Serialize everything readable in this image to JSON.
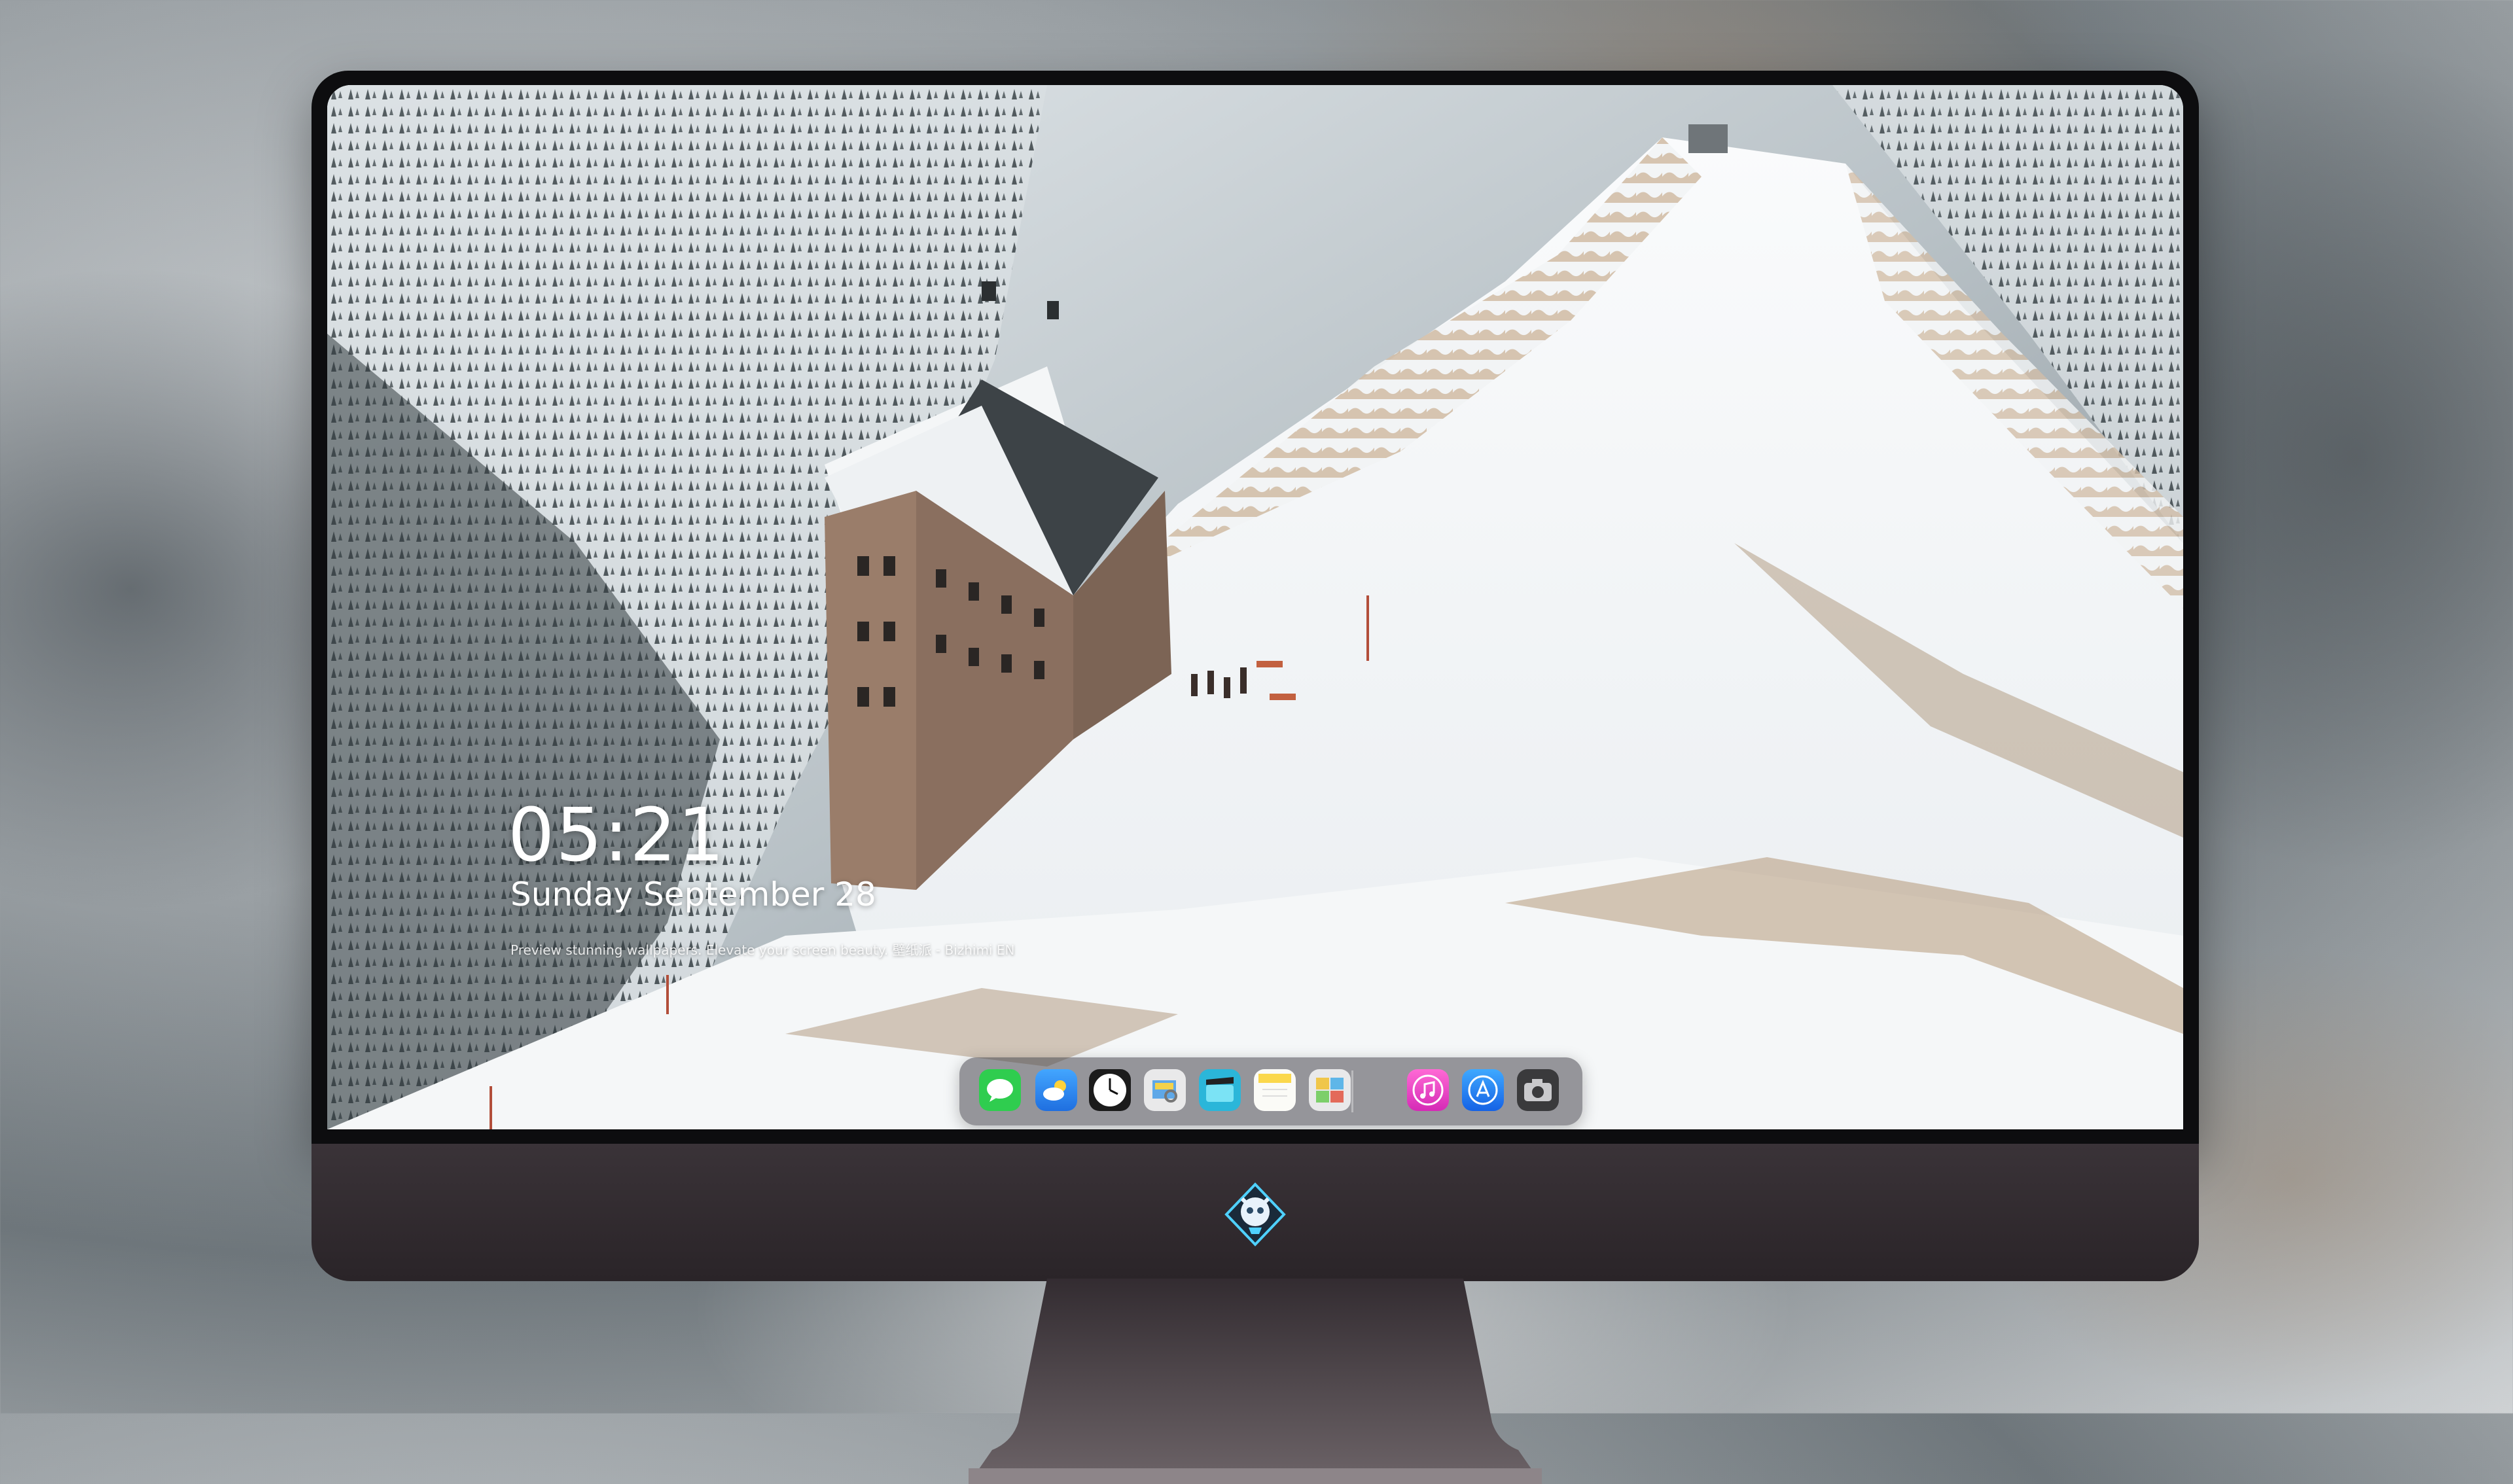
{
  "lockscreen": {
    "time": "05:21",
    "date": "Sunday September  28",
    "caption": "Preview stunning wallpapers. Elevate your screen beauty. 壁纸派 - Bizhimi EN"
  },
  "dock": {
    "apps": [
      {
        "name": "messages-icon",
        "color": "#2fcd4f"
      },
      {
        "name": "weather-icon",
        "color": "#2d8ff0"
      },
      {
        "name": "clock-icon",
        "color": "#1b1b1b"
      },
      {
        "name": "preview-icon",
        "color": "#f3d24a"
      },
      {
        "name": "clips-icon",
        "color": "#2bb6d9"
      },
      {
        "name": "notes-icon",
        "color": "#fbd84c"
      },
      {
        "name": "photo-browser-icon",
        "color": "#e9e9ea"
      },
      {
        "name": "music-icon",
        "color": "#f14dc8"
      },
      {
        "name": "app-store-icon",
        "color": "#1e7cf2"
      },
      {
        "name": "camera-icon",
        "color": "#3a3a3c"
      }
    ]
  }
}
